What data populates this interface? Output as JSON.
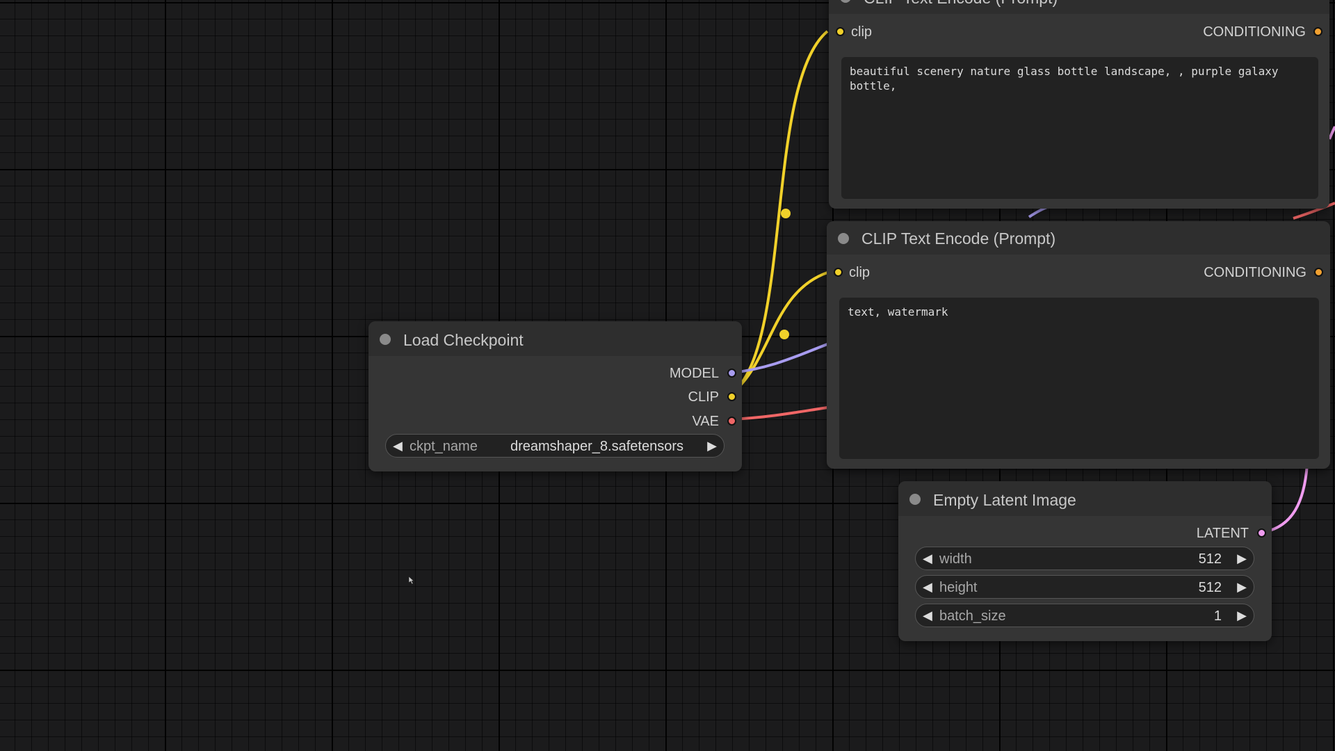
{
  "colors": {
    "clip": "#f1d12a",
    "model": "#a89cf0",
    "vae": "#f06666",
    "latent": "#f09cf0",
    "conditioning": "#f0a030"
  },
  "clip_text_encode_top": {
    "title": "CLIP Text Encode (Prompt)",
    "input_label": "clip",
    "output_label": "CONDITIONING",
    "text": "beautiful scenery nature glass bottle landscape, , purple galaxy bottle,"
  },
  "clip_text_encode_bottom": {
    "title": "CLIP Text Encode (Prompt)",
    "input_label": "clip",
    "output_label": "CONDITIONING",
    "text": "text, watermark"
  },
  "load_checkpoint": {
    "title": "Load Checkpoint",
    "outputs": [
      "MODEL",
      "CLIP",
      "VAE"
    ],
    "widget_name": "ckpt_name",
    "widget_value": "dreamshaper_8.safetensors"
  },
  "empty_latent_image": {
    "title": "Empty Latent Image",
    "output_label": "LATENT",
    "widgets": [
      {
        "name": "width",
        "value": "512"
      },
      {
        "name": "height",
        "value": "512"
      },
      {
        "name": "batch_size",
        "value": "1"
      }
    ]
  },
  "icons": {
    "left_arrow": "◀",
    "right_arrow": "▶"
  }
}
